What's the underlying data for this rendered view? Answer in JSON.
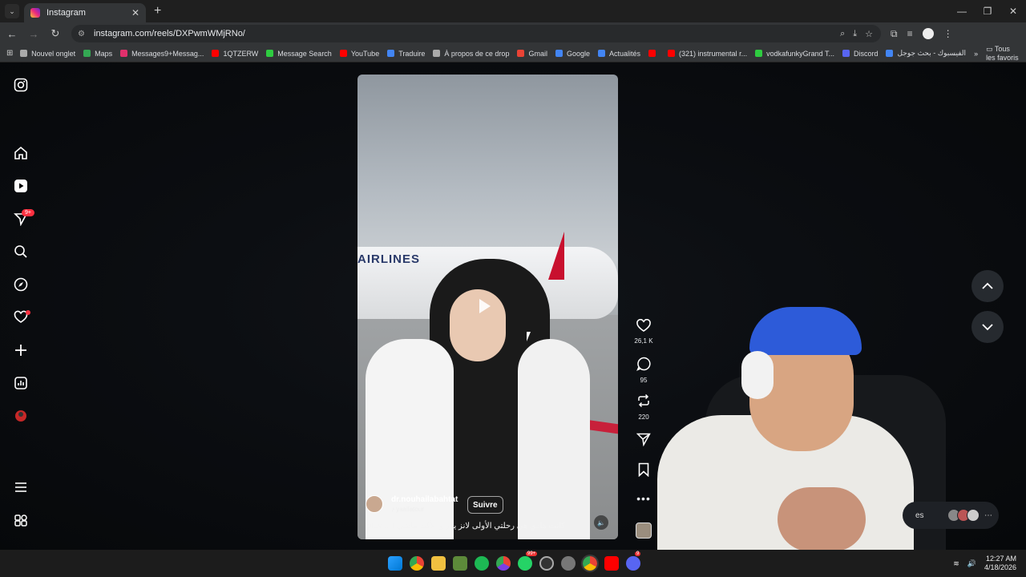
{
  "browser": {
    "tab_title": "Instagram",
    "url": "instagram.com/reels/DXPwmWMjRNo/",
    "bookmarks": [
      {
        "label": "Nouvel onglet",
        "color": "#aaaaaa"
      },
      {
        "label": "Maps",
        "color": "#34a853"
      },
      {
        "label": "Messages9+Messag...",
        "color": "#e1306c"
      },
      {
        "label": "1QTZERW",
        "color": "#ff0000"
      },
      {
        "label": "Message Search",
        "color": "#2ecc40"
      },
      {
        "label": "YouTube",
        "color": "#ff0000"
      },
      {
        "label": "Traduire",
        "color": "#4285f4"
      },
      {
        "label": "À propos de ce drop",
        "color": "#aaaaaa"
      },
      {
        "label": "Gmail",
        "color": "#ea4335"
      },
      {
        "label": "Google",
        "color": "#4285f4"
      },
      {
        "label": "Actualités",
        "color": "#4285f4"
      },
      {
        "label": "",
        "color": "#ff0000"
      },
      {
        "label": "(321) instrumental r...",
        "color": "#ff0000"
      },
      {
        "label": "vodkafunkyGrand T...",
        "color": "#2ecc40"
      },
      {
        "label": "Discord",
        "color": "#5865f2"
      },
      {
        "label": "الفيسبوك - بحث جوجل",
        "color": "#4285f4"
      }
    ],
    "all_bookmarks_label": "Tous les favoris"
  },
  "sidebar": {
    "notifications_badge": "9+"
  },
  "reel": {
    "plane_text": "AIRLINES",
    "username": "dr.nouhailabahtat",
    "audio": "yaallatour",
    "follow_label": "Suivre",
    "caption": "plus ... كانت هادي هي رحلتي الأولى لانز يبار و الأكيد ماشي ا",
    "likes": "26,1 K",
    "comments": "95",
    "reposts": "220"
  },
  "messages": {
    "label": "es"
  },
  "taskbar": {
    "time": "12:27 AM",
    "date": "4/18/2026",
    "badge_a": "99+",
    "badge_b": "9"
  }
}
